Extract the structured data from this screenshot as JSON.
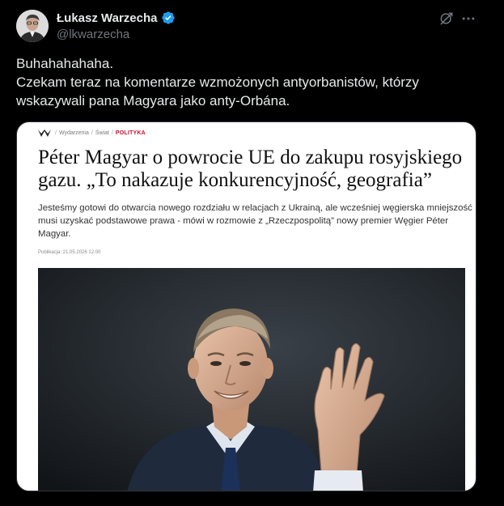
{
  "author": {
    "name": "Łukasz Warzecha",
    "handle": "@lkwarzecha",
    "verified": true
  },
  "tweet": {
    "lines": [
      "Buhahahahaha.",
      "Czekam teraz na komentarze wzmożonych antyorbanistów, którzy",
      "wskazywali pana Magyara jako anty-Orbána."
    ]
  },
  "actions": {
    "grok_icon": "grok-icon",
    "more_icon": "more-icon"
  },
  "article": {
    "breadcrumbs": [
      "Wydarzenia",
      "Świat",
      "POLITYKA"
    ],
    "headline_lines": [
      "Péter Magyar o powrocie UE do zakupu rosyjskiego",
      "gazu. „To nakazuje konkurencyjność, geografia”"
    ],
    "lead_lines": [
      "Jesteśmy gotowi do otwarcia nowego rozdziału w relacjach z Ukrainą, ale wcześniej węgierska mniejszość",
      "musi uzyskać podstawowe prawa - mówi w rozmowie z „Rzeczpospolitą” nowy premier Węgier Péter",
      "Magyar."
    ],
    "published": "Publikacja: 21.05.2026 12:00",
    "photo_subject": "man in suit gesturing with raised hand"
  },
  "colors": {
    "background": "#000000",
    "text": "#e7e9ea",
    "muted": "#71767b",
    "verified": "#1d9bf0",
    "category": "#c8102e"
  }
}
